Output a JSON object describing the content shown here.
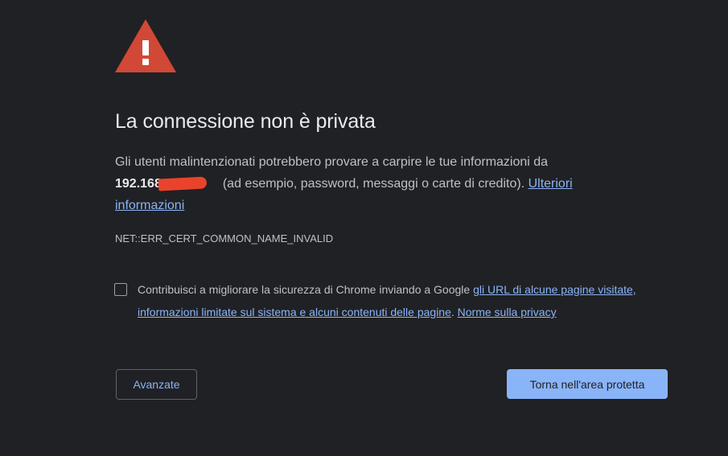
{
  "icons": {
    "warning": "warning-triangle-icon"
  },
  "colors": {
    "background": "#202124",
    "warning": "#d14836",
    "heading": "#e8eaed",
    "body_text": "#bdc1c6",
    "link": "#8ab4f8",
    "primary_button_bg": "#8ab4f8",
    "redaction": "#e9432c"
  },
  "interstitial": {
    "heading": "La connessione non è privata",
    "intro_text": "Gli utenti malintenzionati potrebbero provare a carpire le tue informazioni da",
    "host_visible": "192.168",
    "details_text": "(ad esempio, password, messaggi o carte di credito).",
    "learn_more_link": "Ulteriori informazioni",
    "error_code": "NET::ERR_CERT_COMMON_NAME_INVALID"
  },
  "optin": {
    "checked": false,
    "text": "Contribuisci a migliorare la sicurezza di Chrome inviando a Google",
    "link_label": "gli URL di alcune pagine visitate, informazioni limitate sul sistema e alcuni contenuti delle pagine",
    "separator": ".",
    "privacy_link": "Norme sulla privacy"
  },
  "buttons": {
    "advanced": "Avanzate",
    "back_to_safety": "Torna nell'area protetta"
  }
}
